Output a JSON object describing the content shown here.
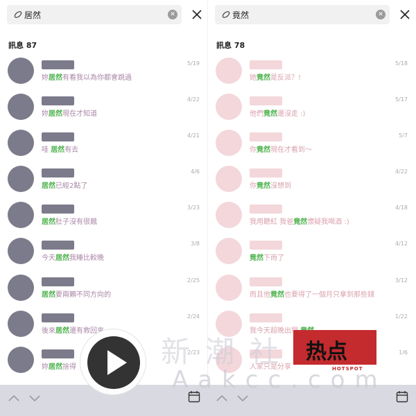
{
  "left": {
    "search_query": "居然",
    "count_label": "訊息 87",
    "results": [
      {
        "pre": "妳",
        "hl": "居然",
        "post": "有看我以為你都會跳過",
        "date": "5/19"
      },
      {
        "pre": "妳",
        "hl": "居然",
        "post": "現在才知道",
        "date": "4/22"
      },
      {
        "pre": "哇 ",
        "hl": "居然",
        "post": "有去",
        "date": "4/21"
      },
      {
        "pre": "",
        "hl": "居然",
        "post": "已經2點了",
        "date": "4/6"
      },
      {
        "pre": "",
        "hl": "居然",
        "post": "肚子沒有很餓",
        "date": "3/23"
      },
      {
        "pre": "今天",
        "hl": "居然",
        "post": "我睡比較晚",
        "date": "3/8"
      },
      {
        "pre": "",
        "hl": "居然",
        "post": "要兩顆不同方向的",
        "date": "2/25"
      },
      {
        "pre": "後來",
        "hl": "居然",
        "post": "還有救回來",
        "date": "2/24"
      },
      {
        "pre": "妳",
        "hl": "居然",
        "post": "捨得",
        "date": "2/23"
      }
    ]
  },
  "right": {
    "search_query": "竟然",
    "count_label": "訊息 78",
    "results": [
      {
        "pre": "她",
        "hl": "竟然",
        "post": "是反派？!",
        "date": "5/18"
      },
      {
        "pre": "他們",
        "hl": "竟然",
        "post": "還沒走 :)",
        "date": "5/17"
      },
      {
        "pre": "你",
        "hl": "竟然",
        "post": "現在才看到～",
        "date": "5/7"
      },
      {
        "pre": "你",
        "hl": "竟然",
        "post": "沒想到",
        "date": "4/22"
      },
      {
        "pre": "我用聽紅 我爸",
        "hl": "竟然",
        "post": "懷疑我喝酒 :)",
        "date": "4/18"
      },
      {
        "pre": "",
        "hl": "竟然",
        "post": "下雨了",
        "date": "4/12"
      },
      {
        "pre": "而且他",
        "hl": "竟然",
        "post": "也要得了一個月只拿到那些錢",
        "date": "3/12"
      },
      {
        "pre": "我今天超晚出門 ",
        "hl": "竟然",
        "post": "",
        "date": "1/22"
      },
      {
        "pre": "人家只是分享",
        "hl": "",
        "post": "",
        "date": "1/6"
      }
    ]
  },
  "icons": {
    "search": "pill-icon",
    "clear": "clear-circle-icon",
    "close": "close-icon",
    "up": "chevron-up-icon",
    "down": "chevron-down-icon",
    "calendar": "calendar-icon",
    "play": "play-icon"
  },
  "colors": {
    "highlight": "#4cb24c",
    "bottom_bar": "#d9d9e1",
    "avatar_left": "#7c7b8b",
    "avatar_right": "#f3d7db"
  },
  "watermark": {
    "title": "新潮社",
    "url": "Aakcc.com",
    "hot_label": "热点",
    "hot_sub": "HOTSPOT"
  }
}
